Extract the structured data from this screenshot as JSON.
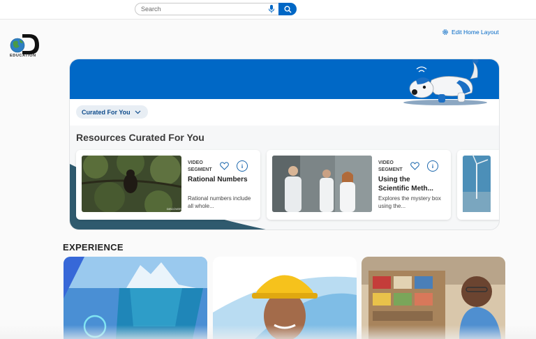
{
  "search": {
    "placeholder": "Search"
  },
  "logo": {
    "text": "EDUCATION"
  },
  "edit_home_layout": "Edit Home Layout",
  "curated": {
    "dropdown_label": "Curated For You",
    "section_title": "Resources Curated For You",
    "cards": [
      {
        "type": "VIDEO SEGMENT",
        "title": "Rational Numbers",
        "description": "Rational numbers include all whole..."
      },
      {
        "type": "VIDEO SEGMENT",
        "title": "Using the Scientific Meth...",
        "description": "Explores the mystery box using the..."
      }
    ]
  },
  "experience": {
    "title": "EXPERIENCE"
  },
  "colors": {
    "brand_blue": "#0067c5",
    "banner_blue": "#0068c6",
    "dark_teal": "#2f5a6e"
  }
}
